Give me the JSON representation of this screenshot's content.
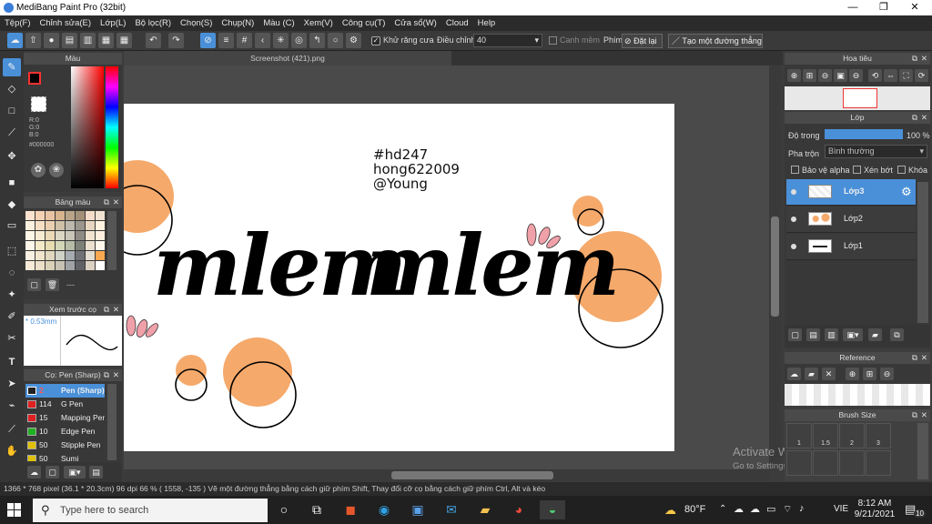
{
  "window": {
    "title": "MediBang Paint Pro (32bit)",
    "minimize": "—",
    "maximize": "❐",
    "close": "✕"
  },
  "menu": [
    "Tệp(F)",
    "Chỉnh sửa(E)",
    "Lớp(L)",
    "Bộ lọc(R)",
    "Chọn(S)",
    "Chụp(N)",
    "Màu (C)",
    "Xem(V)",
    "Công cụ(T)",
    "Cửa sổ(W)",
    "Cloud",
    "Help"
  ],
  "toolbar": {
    "antialias_label": "Khử răng cưa",
    "adjust_label": "Điều chỉnh",
    "adjust_value": "40",
    "smooth_label": "Canh mềm",
    "key_label": "Phím",
    "reset_label": "Đặt lại",
    "straight_label": "Tạo một đường thẳng"
  },
  "tab": {
    "file_name": "Screenshot (421).png"
  },
  "color_panel": {
    "title": "Màu",
    "r": "R:0",
    "g": "G:0",
    "b": "B:0",
    "hex": "#000000"
  },
  "palette_panel": {
    "title": "Bảng màu",
    "dash": "---"
  },
  "preview_panel": {
    "title": "Xem trước cọ",
    "size": "0.53mm"
  },
  "brush_panel": {
    "title": "Cọ: Pen (Sharp)",
    "brushes": [
      {
        "size": "2",
        "name": "Pen (Sharp)",
        "color": "#ff4040"
      },
      {
        "size": "114",
        "name": "G Pen",
        "color": "#e02020"
      },
      {
        "size": "15",
        "name": "Mapping Pen",
        "color": "#e02020"
      },
      {
        "size": "10",
        "name": "Edge Pen",
        "color": "#20b020"
      },
      {
        "size": "50",
        "name": "Stipple Pen",
        "color": "#e0c000"
      },
      {
        "size": "50",
        "name": "Sumi",
        "color": "#e0c000"
      }
    ]
  },
  "navigator_panel": {
    "title": "Hoa tiêu"
  },
  "layer_panel": {
    "title": "Lớp",
    "opacity_label": "Độ trong",
    "opacity_value": "100 %",
    "blend_label": "Pha trộn",
    "blend_value": "Bình thường",
    "protect_alpha": "Bảo vệ alpha",
    "clipping": "Xén bớt",
    "lock": "Khóa",
    "layers": [
      "Lớp3",
      "Lớp2",
      "Lớp1"
    ]
  },
  "reference_panel": {
    "title": "Reference"
  },
  "brushsize_panel": {
    "title": "Brush Size",
    "sizes": [
      "1",
      "1.5",
      "2",
      "3"
    ]
  },
  "artwork": {
    "line1": "#hd247",
    "line2": "hong622009",
    "line3": "@Young",
    "word1": "mlem",
    "word2": "mlem"
  },
  "watermark": {
    "line1": "Activate Windows",
    "line2": "Go to Settings to activate Windows."
  },
  "status": {
    "text": "1366 * 768 pixel   (36.1 * 20.3cm)   96 dpi   66 %   ( 1558, -135 )   Vẽ một đường thẳng bằng cách giữ phím Shift, Thay đổi cỡ cọ bằng cách giữ phím Ctrl, Alt và kéo"
  },
  "taskbar": {
    "search_placeholder": "Type here to search",
    "temp": "80°F",
    "lang": "VIE",
    "time": "8:12 AM",
    "date": "9/21/2021",
    "notif": "10"
  },
  "colors": {
    "accent": "#4a90d9",
    "peach": "#f5a96b",
    "pink": "#f0a0a8"
  }
}
